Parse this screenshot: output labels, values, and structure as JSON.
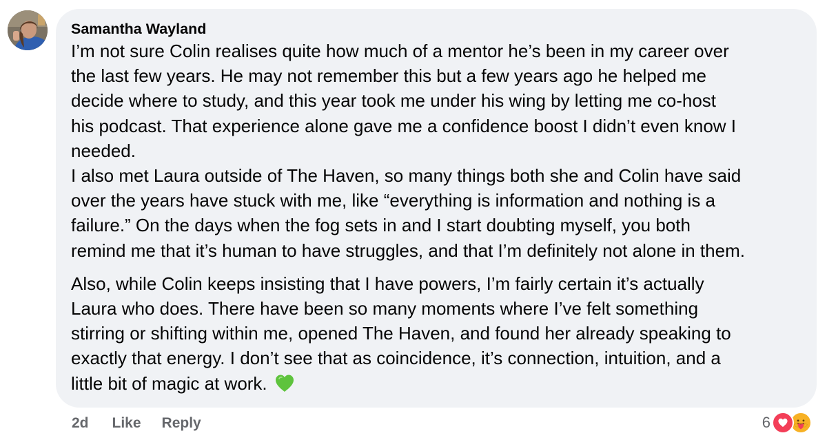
{
  "comment": {
    "author": "Samantha Wayland",
    "paragraphs": [
      {
        "lines": [
          "I’m not sure Colin realises quite how much of a mentor he’s been in my career over",
          "the last few years. He may not remember this but a few years ago he helped me",
          "decide where to study, and this year took me under his wing by letting me co-host",
          "his podcast. That experience alone gave me a confidence boost I didn’t even know I",
          "needed.",
          "I also met Laura outside of The Haven, so many things both she and Colin have said",
          "over the years have stuck with me, like “everything is information and nothing is a",
          "failure.” On the days when the fog sets in and I start doubting myself, you both",
          "remind me that it’s human to have struggles, and that I’m definitely not alone in them."
        ]
      },
      {
        "lines": [
          "Also, while Colin keeps insisting that I have powers, I’m fairly certain it’s actually",
          "Laura who does. There have been so many moments where I’ve felt something",
          "stirring or shifting within me, opened The Haven, and found her already speaking to",
          "exactly that energy. I don’t see that as coincidence, it’s connection, intuition, and a",
          "little bit of magic at work."
        ],
        "trailing_emoji": "green-heart-icon"
      }
    ],
    "timestamp": "2d",
    "actions": {
      "like_label": "Like",
      "reply_label": "Reply"
    },
    "reactions": {
      "count": "6",
      "types": [
        "love-reaction-icon",
        "care-reaction-icon"
      ]
    }
  },
  "colors": {
    "bubble_background": "#f0f2f5",
    "text_primary": "#050505",
    "text_secondary": "#65676b",
    "love_red": "#f33e58",
    "care_yellow": "#f7b125",
    "heart_green": "#5ec33d"
  }
}
